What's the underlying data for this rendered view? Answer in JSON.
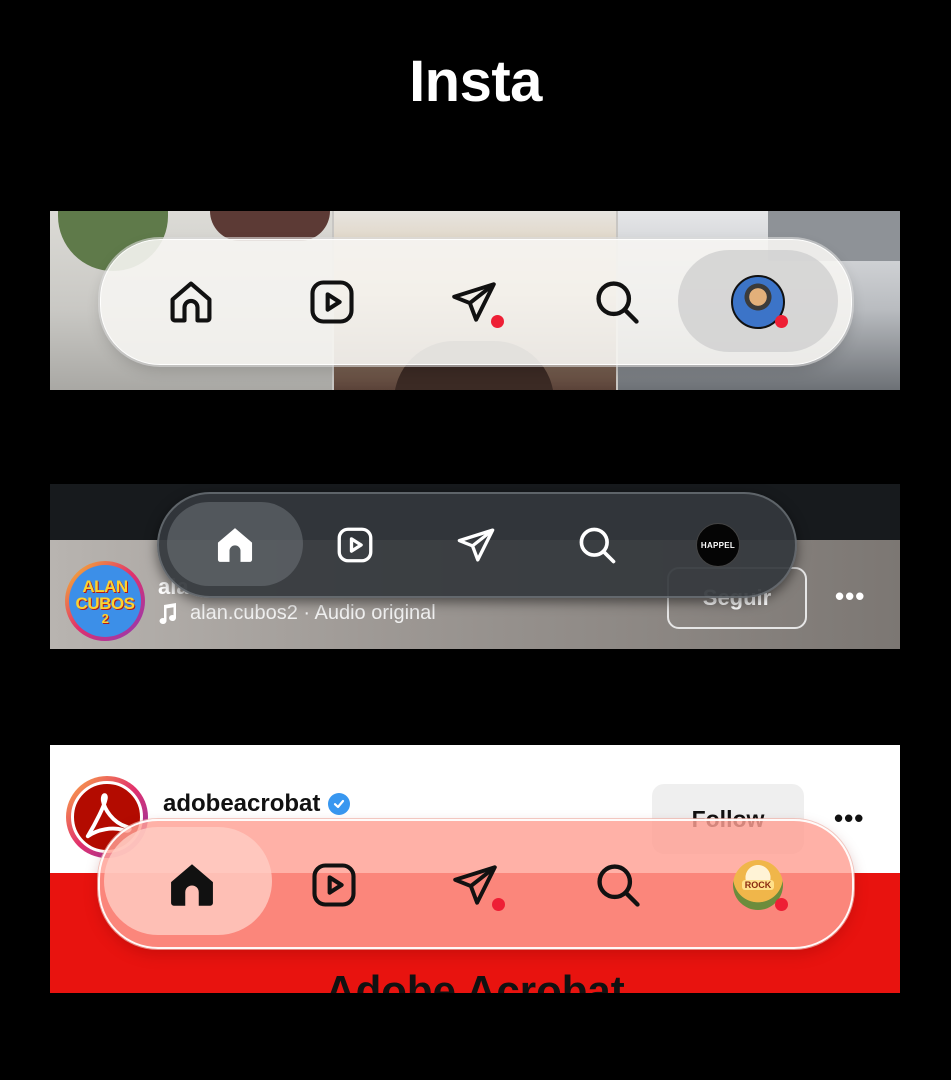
{
  "page": {
    "title": "Insta"
  },
  "nav_icons": [
    "home-icon",
    "reels-icon",
    "direct-message-icon",
    "search-icon",
    "profile-avatar"
  ],
  "panel_1": {
    "style": "light glass",
    "active_tab": "profile",
    "dm_unread_dot": true,
    "profile_unread_dot": true
  },
  "panel_2": {
    "style": "dark glass",
    "active_tab": "home",
    "profile_avatar_text": "HAPPEL",
    "reel": {
      "avatar_text_top": "ALAN",
      "avatar_text_bottom": "CUBOS",
      "avatar_text_num": "2",
      "username_visible": "ala",
      "audio": "alan.cubos2 · Audio original",
      "follow_label": "Seguir",
      "more_label": "•••"
    }
  },
  "panel_3": {
    "style": "tinted glass",
    "active_tab": "home",
    "dm_unread_dot": true,
    "profile_unread_dot": true,
    "profile_avatar_text": "ROCK",
    "post": {
      "username": "adobeacrobat",
      "verified": true,
      "follow_label": "Follow",
      "more_label": "•••",
      "headline": "Adobe Acrobat"
    }
  },
  "colors": {
    "background": "#000000",
    "notification_dot": "#ee1f35",
    "adobe_red": "#e8130f",
    "verified_blue": "#3897f0"
  }
}
